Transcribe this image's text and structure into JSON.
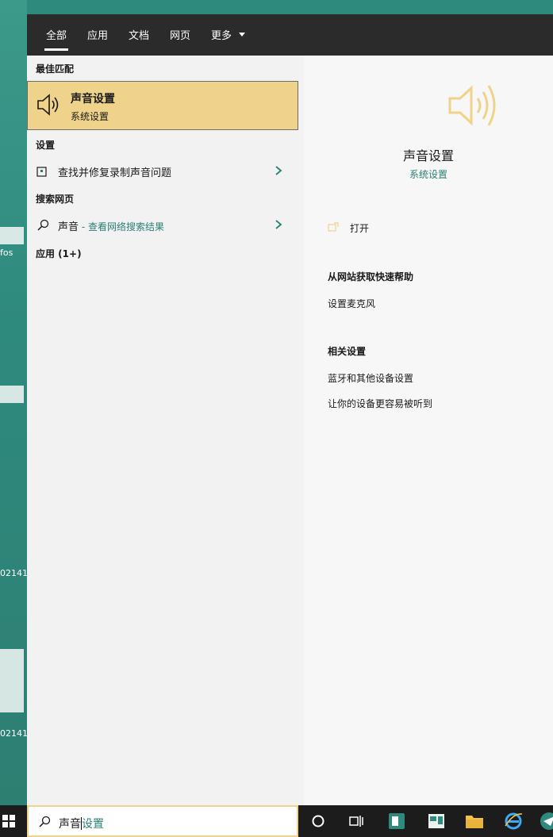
{
  "tabs": [
    {
      "label": "全部",
      "active": true
    },
    {
      "label": "应用",
      "active": false
    },
    {
      "label": "文档",
      "active": false
    },
    {
      "label": "网页",
      "active": false
    },
    {
      "label": "更多",
      "active": false
    }
  ],
  "left": {
    "best_match": {
      "header": "最佳匹配",
      "title": "声音设置",
      "subtitle": "系统设置",
      "icon": "speaker-icon"
    },
    "settings": {
      "header": "设置",
      "item": {
        "label": "查找并修复录制声音问题",
        "icon": "troubleshoot-icon"
      }
    },
    "web": {
      "header": "搜索网页",
      "item": {
        "query": "声音",
        "suffix": " - 查看网络搜索结果",
        "icon": "search-icon"
      }
    },
    "apps": {
      "header": "应用 (1+)"
    }
  },
  "right": {
    "title": "声音设置",
    "subtitle": "系统设置",
    "open_label": "打开",
    "help_header": "从网站获取快速帮助",
    "help_links": [
      "设置麦克风"
    ],
    "related_header": "相关设置",
    "related_links": [
      "蓝牙和其他设备设置",
      "让你的设备更容易被听到"
    ]
  },
  "search": {
    "typed": "声音",
    "suggestion": "设置"
  },
  "desktop": {
    "labels": [
      "fos",
      "02141",
      "02141"
    ]
  },
  "colors": {
    "accent": "#efd38a",
    "teal": "#2a7f73",
    "dark": "#2b2b2b"
  }
}
